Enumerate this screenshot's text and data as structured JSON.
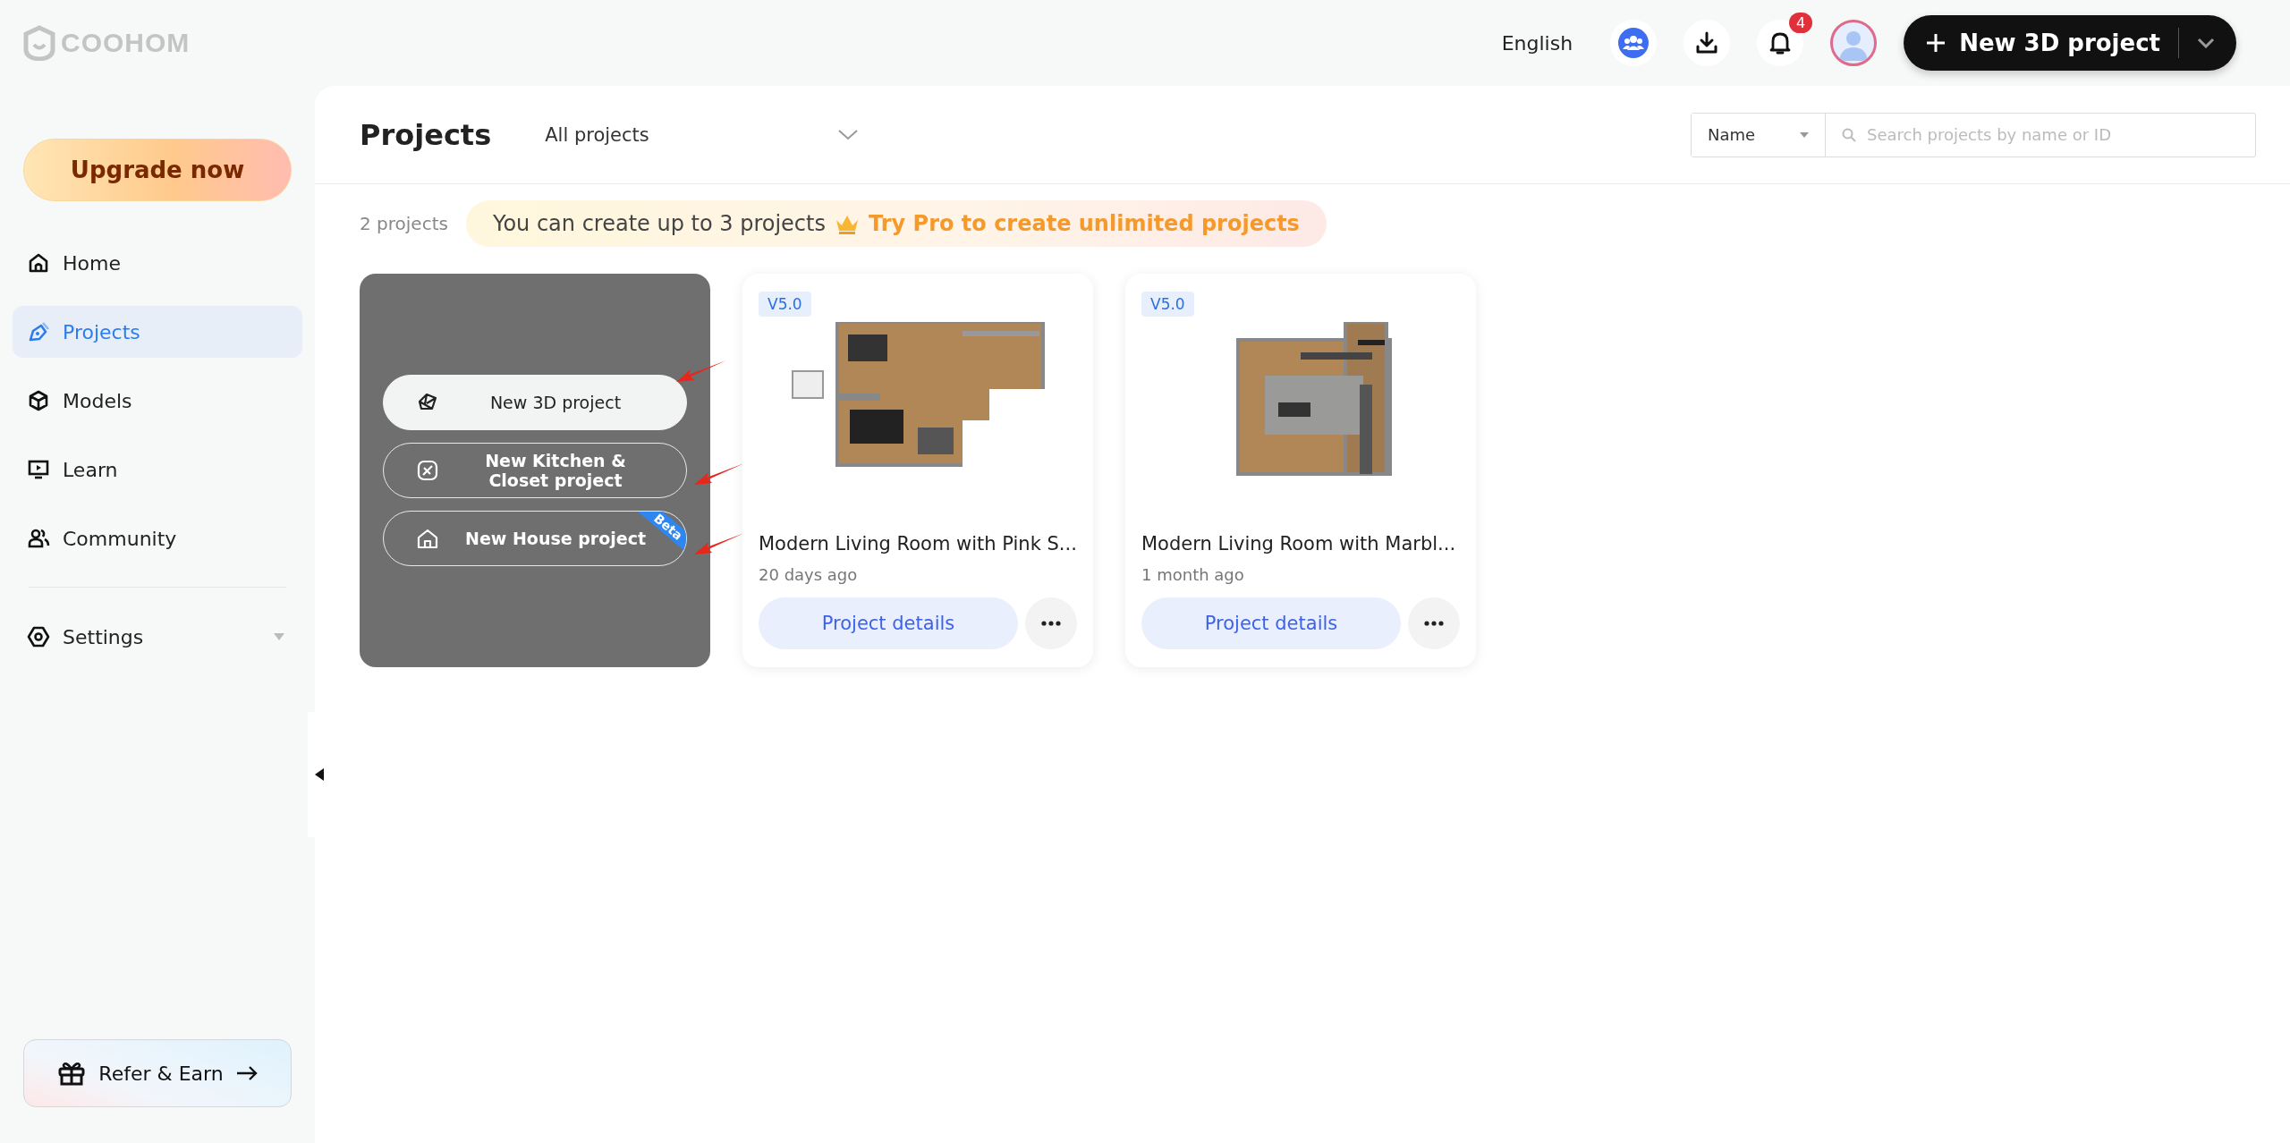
{
  "logo": {
    "text": "COOHOM"
  },
  "top_bar": {
    "language": "English",
    "notifications": {
      "count": "4"
    },
    "new_button": {
      "label": "New 3D project"
    }
  },
  "sidebar": {
    "upgrade": {
      "label": "Upgrade now"
    },
    "items": [
      {
        "kind": "home",
        "label": "Home",
        "selected": false
      },
      {
        "kind": "projects",
        "label": "Projects",
        "selected": true
      },
      {
        "kind": "models",
        "label": "Models",
        "selected": false
      },
      {
        "kind": "learn",
        "label": "Learn",
        "selected": false
      },
      {
        "kind": "community",
        "label": "Community",
        "selected": false
      }
    ],
    "settings": {
      "label": "Settings",
      "expanded": false
    },
    "refer": {
      "label": "Refer & Earn"
    }
  },
  "header": {
    "title": "Projects",
    "filter": {
      "value": "All projects"
    },
    "sort": {
      "value": "Name"
    },
    "search": {
      "placeholder": "Search projects by name or ID"
    }
  },
  "info": {
    "count": "2 projects",
    "limit_text": "You can create up to 3 projects",
    "pro_link": "Try Pro to create unlimited projects"
  },
  "create_menu": [
    {
      "kind": "model",
      "label": "New 3D project",
      "highlighted": true
    },
    {
      "kind": "kitchen",
      "label": "New Kitchen & Closet project",
      "highlighted": false
    },
    {
      "kind": "house",
      "label": "New House project",
      "highlighted": false,
      "badge": "Beta"
    }
  ],
  "projects": [
    {
      "version": "V5.0",
      "title": "Modern Living Room with Pink S...",
      "time": "20 days ago",
      "button": "Project details"
    },
    {
      "version": "V5.0",
      "title": "Modern Living Room with Marbl...",
      "time": "1 month ago",
      "button": "Project details"
    }
  ]
}
